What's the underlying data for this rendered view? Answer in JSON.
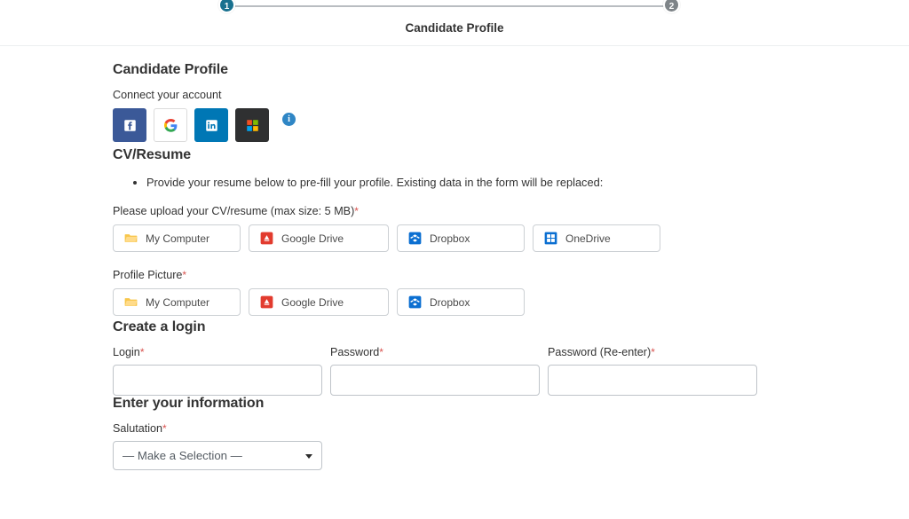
{
  "stepper": {
    "steps": [
      {
        "number": "1",
        "state": "active"
      },
      {
        "number": "2",
        "state": "inactive"
      }
    ],
    "current_title": "Candidate Profile",
    "active_color": "#19718f",
    "inactive_color": "#7e8488"
  },
  "page": {
    "title": "Candidate Profile"
  },
  "connect": {
    "label": "Connect your account",
    "providers": [
      {
        "name": "Facebook",
        "icon": "facebook-icon",
        "color": "#3b5998"
      },
      {
        "name": "Google",
        "icon": "google-icon",
        "color": "#ffffff"
      },
      {
        "name": "LinkedIn",
        "icon": "linkedin-icon",
        "color": "#0077b5"
      },
      {
        "name": "Microsoft",
        "icon": "microsoft-icon",
        "color": "#2f3031"
      }
    ],
    "info_glyph": "i",
    "info_color": "#2f86c5"
  },
  "cv_resume": {
    "heading": "CV/Resume",
    "bullets": [
      "Provide your resume below to pre-fill your profile. Existing data in the form will be replaced:"
    ],
    "upload_label": "Please upload your CV/resume (max size: 5 MB)",
    "required_marker": "*",
    "sources": [
      {
        "label": "My Computer",
        "icon": "folder-icon"
      },
      {
        "label": "Google Drive",
        "icon": "google-drive-icon"
      },
      {
        "label": "Dropbox",
        "icon": "dropbox-icon"
      },
      {
        "label": "OneDrive",
        "icon": "onedrive-icon"
      }
    ]
  },
  "profile_picture": {
    "label": "Profile Picture",
    "required_marker": "*",
    "sources": [
      {
        "label": "My Computer",
        "icon": "folder-icon"
      },
      {
        "label": "Google Drive",
        "icon": "google-drive-icon"
      },
      {
        "label": "Dropbox",
        "icon": "dropbox-icon"
      }
    ]
  },
  "create_login": {
    "heading": "Create a login",
    "fields": [
      {
        "label": "Login",
        "required_marker": "*",
        "value": "",
        "placeholder": ""
      },
      {
        "label": "Password",
        "required_marker": "*",
        "value": "",
        "placeholder": ""
      },
      {
        "label": "Password (Re-enter)",
        "required_marker": "*",
        "value": "",
        "placeholder": ""
      }
    ]
  },
  "enter_information": {
    "heading": "Enter your information",
    "salutation": {
      "label": "Salutation",
      "required_marker": "*",
      "selected": "— Make a Selection —"
    }
  }
}
